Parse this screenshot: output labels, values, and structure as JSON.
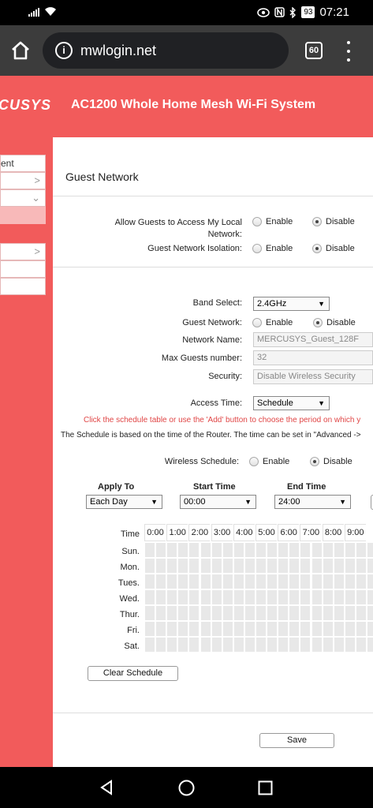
{
  "status_bar": {
    "battery": "93",
    "time": "07:21",
    "icons": [
      "signal-icon",
      "wifi-icon",
      "eye-icon",
      "nfc-icon",
      "bluetooth-icon",
      "battery-icon"
    ]
  },
  "browser": {
    "url": "mwlogin.net",
    "tab_count": "60"
  },
  "header": {
    "logo": "CUSYS",
    "product": "AC1200 Whole Home Mesh Wi-Fi System"
  },
  "sidebar": {
    "items": [
      {
        "label": "ent"
      },
      {
        "label": ""
      },
      {
        "label": ""
      },
      {
        "label": ""
      },
      {
        "label": ""
      },
      {
        "label": ""
      },
      {
        "label": ""
      }
    ]
  },
  "guest": {
    "title": "Guest Network",
    "allow_label": "Allow Guests to Access My Local Network:",
    "allow_enable": "Enable",
    "allow_disable": "Disable",
    "isolation_label": "Guest Network Isolation:",
    "iso_enable": "Enable",
    "iso_disable": "Disable",
    "band_label": "Band Select:",
    "band_value": "2.4GHz",
    "gn_label": "Guest Network:",
    "gn_enable": "Enable",
    "gn_disable": "Disable",
    "name_label": "Network Name:",
    "name_value": "MERCUSYS_Guest_128F",
    "max_label": "Max Guests number:",
    "max_value": "32",
    "sec_label": "Security:",
    "sec_value": "Disable Wireless Security",
    "access_label": "Access Time:",
    "access_value": "Schedule",
    "note_red": "Click the schedule table or use the 'Add' button to choose the period on which y",
    "note": "The Schedule is based on the time of the Router. The time can be set in \"Advanced ->",
    "ws_label": "Wireless Schedule:",
    "ws_enable": "Enable",
    "ws_disable": "Disable"
  },
  "schedule": {
    "apply_to_head": "Apply To",
    "start_head": "Start Time",
    "end_head": "End Time",
    "apply_to": "Each Day",
    "start": "00:00",
    "end": "24:00",
    "time_label": "Time",
    "hours": [
      "0:00",
      "1:00",
      "2:00",
      "3:00",
      "4:00",
      "5:00",
      "6:00",
      "7:00",
      "8:00",
      "9:00"
    ],
    "days": [
      "Sun.",
      "Mon.",
      "Tues.",
      "Wed.",
      "Thur.",
      "Fri.",
      "Sat."
    ],
    "clear_button": "Clear Schedule",
    "save_button": "Save"
  }
}
